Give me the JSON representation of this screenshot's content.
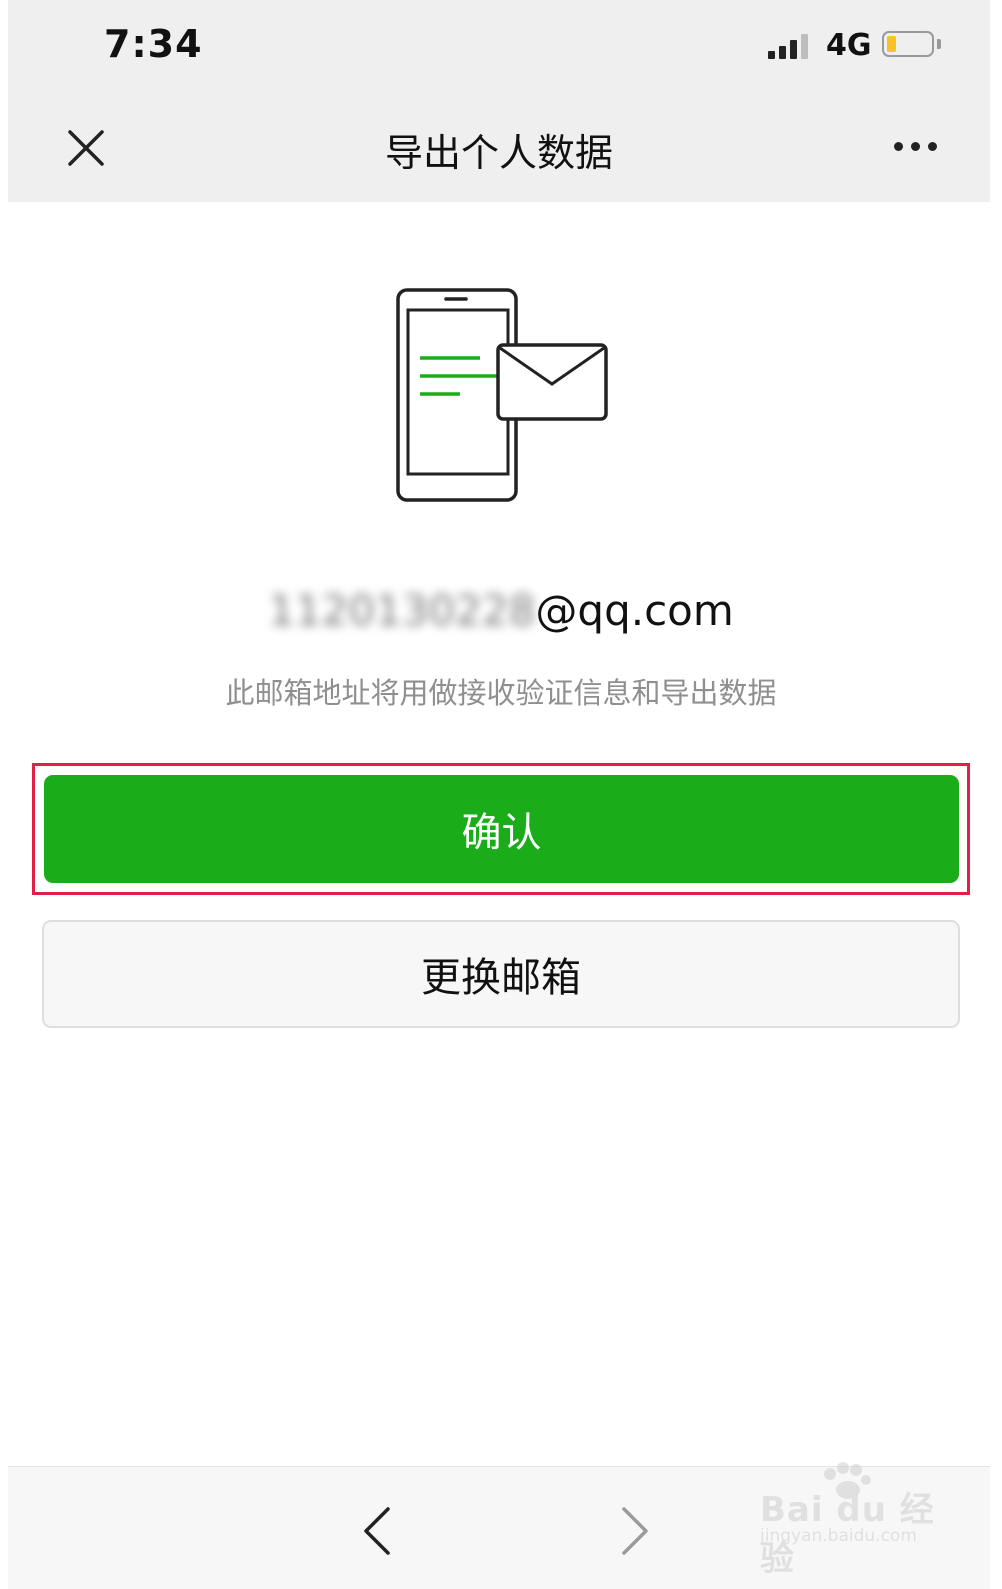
{
  "status_bar": {
    "time": "7:34",
    "network": "4G",
    "battery_level": 0.2
  },
  "nav": {
    "title": "导出个人数据",
    "close_icon": "close-icon",
    "more_icon": "more-icon"
  },
  "content": {
    "email_masked": "1120130228",
    "email_domain": "@qq.com",
    "hint": "此邮箱地址将用做接收验证信息和导出数据"
  },
  "buttons": {
    "confirm": "确认",
    "change_email": "更换邮箱"
  },
  "toolbar": {
    "back_icon": "chevron-left-icon",
    "forward_icon": "chevron-right-icon"
  },
  "watermark": {
    "logo": "Bai du 经验",
    "sub": "jingyan.baidu.com"
  },
  "colors": {
    "primary_green": "#1aad19",
    "highlight_red": "#e02045",
    "illustration_green": "#1aad19"
  }
}
